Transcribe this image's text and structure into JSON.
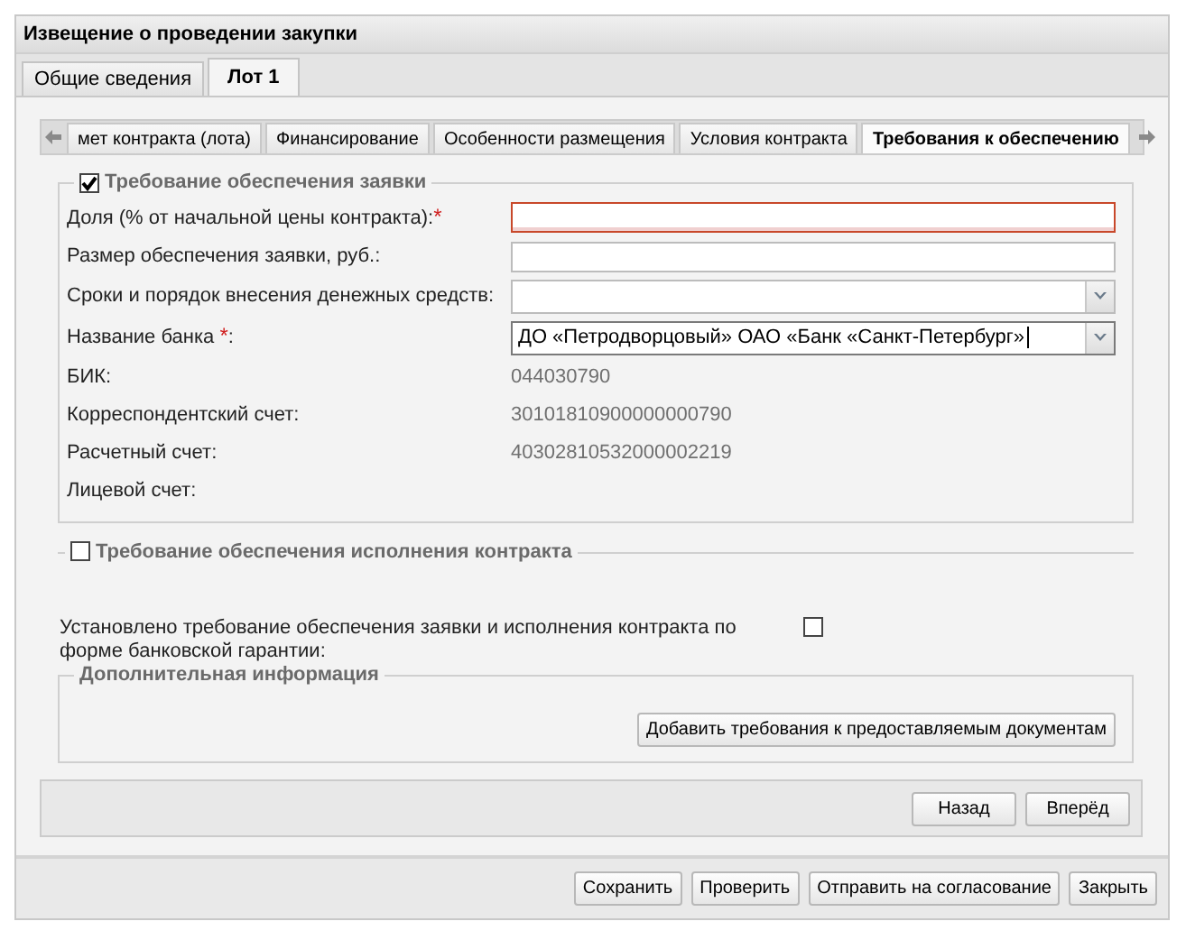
{
  "window": {
    "title": "Извещение о проведении закупки"
  },
  "outer_tabs": [
    {
      "label": "Общие сведения",
      "selected": false
    },
    {
      "label": "Лот 1",
      "selected": true
    }
  ],
  "inner_tabs": [
    {
      "label": "мет контракта (лота)",
      "selected": false
    },
    {
      "label": "Финансирование",
      "selected": false
    },
    {
      "label": "Особенности размещения",
      "selected": false
    },
    {
      "label": "Условия контракта",
      "selected": false
    },
    {
      "label": "Требования к обеспечению",
      "selected": true
    }
  ],
  "application_security": {
    "title": "Требование обеспечения заявки",
    "checked": true,
    "fields": [
      {
        "kind": "input",
        "label": "Доля (% от начальной цены контракта):",
        "required_mark": "*",
        "invalid": true
      },
      {
        "kind": "input",
        "label": "Размер обеспечения заявки, руб.:",
        "invalid": false
      },
      {
        "kind": "select",
        "label": "Сроки и порядок внесения денежных средств:"
      },
      {
        "kind": "select",
        "label": "Название банка ",
        "required_mark": "*",
        "label_end": ":",
        "value": "ДО «Петродворцовый» ОАО «Банк «Санкт-Петербург»",
        "focused": true
      },
      {
        "kind": "static",
        "label": "БИК:",
        "value": "044030790"
      },
      {
        "kind": "static",
        "label": "Корреспондентский счет:",
        "value": "30101810900000000790"
      },
      {
        "kind": "static",
        "label": "Расчетный счет:",
        "value": "40302810532000002219"
      },
      {
        "kind": "static",
        "label": "Лицевой счет:"
      }
    ]
  },
  "contract_security": {
    "title": "Требование обеспечения исполнения контракта",
    "checked": false
  },
  "bank_guarantee": {
    "label": "Установлено требование обеспечения заявки и исполнения контракта по форме банковской гарантии:",
    "checked": false
  },
  "additional_info": {
    "title": "Дополнительная информация",
    "button": "Добавить требования к предоставляемым документам"
  },
  "nav_buttons": [
    "Назад",
    "Вперёд"
  ],
  "footer_buttons": [
    "Сохранить",
    "Проверить",
    "Отправить на согласование",
    "Закрыть"
  ]
}
